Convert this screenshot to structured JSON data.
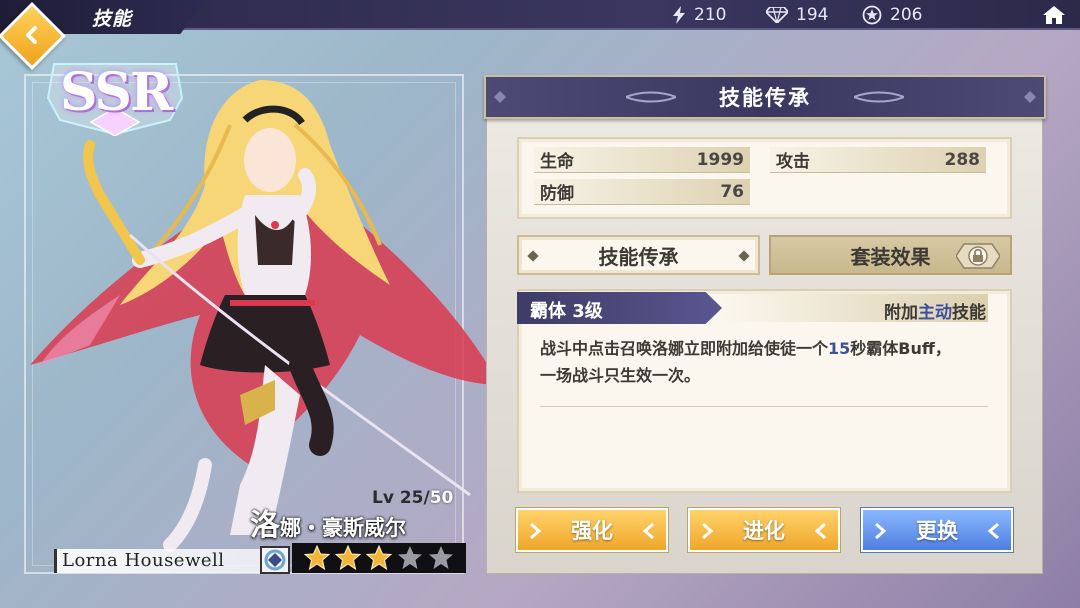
{
  "header": {
    "title": "技能",
    "resources": [
      {
        "icon": "lightning-icon",
        "value": "210"
      },
      {
        "icon": "diamond-icon",
        "value": "194"
      },
      {
        "icon": "star-coin-icon",
        "value": "206"
      }
    ]
  },
  "character": {
    "rarity": "SSR",
    "level_label": "Lv 25/",
    "level_max": "50",
    "name_cn_big": "洛",
    "name_cn_rest": "娜・豪斯威尔",
    "name_en": "Lorna Housewell",
    "stars_filled": 3,
    "stars_total": 5
  },
  "panel": {
    "title": "技能传承",
    "stats": {
      "hp_label": "生命",
      "hp_value": "1999",
      "atk_label": "攻击",
      "atk_value": "288",
      "def_label": "防御",
      "def_value": "76"
    },
    "tabs": {
      "inherit": "技能传承",
      "set_effect": "套装效果"
    },
    "skill": {
      "name": "霸体 3级",
      "tag_prefix": "附加",
      "tag_highlight": "主动",
      "tag_suffix": "技能",
      "desc_part1": "战斗中点击召唤洛娜立即附加给使徒一个",
      "desc_num": "15",
      "desc_part2": "秒霸体Buff，",
      "desc_line2": "一场战斗只生效一次。"
    },
    "buttons": {
      "strengthen": "强化",
      "evolve": "进化",
      "replace": "更换"
    }
  },
  "colors": {
    "topbar": "#2b2847",
    "panel_header": "#3a3761",
    "gold_button": "#f0a62a",
    "blue_button": "#4f7fe0",
    "highlight_text": "#3e4f9e"
  }
}
